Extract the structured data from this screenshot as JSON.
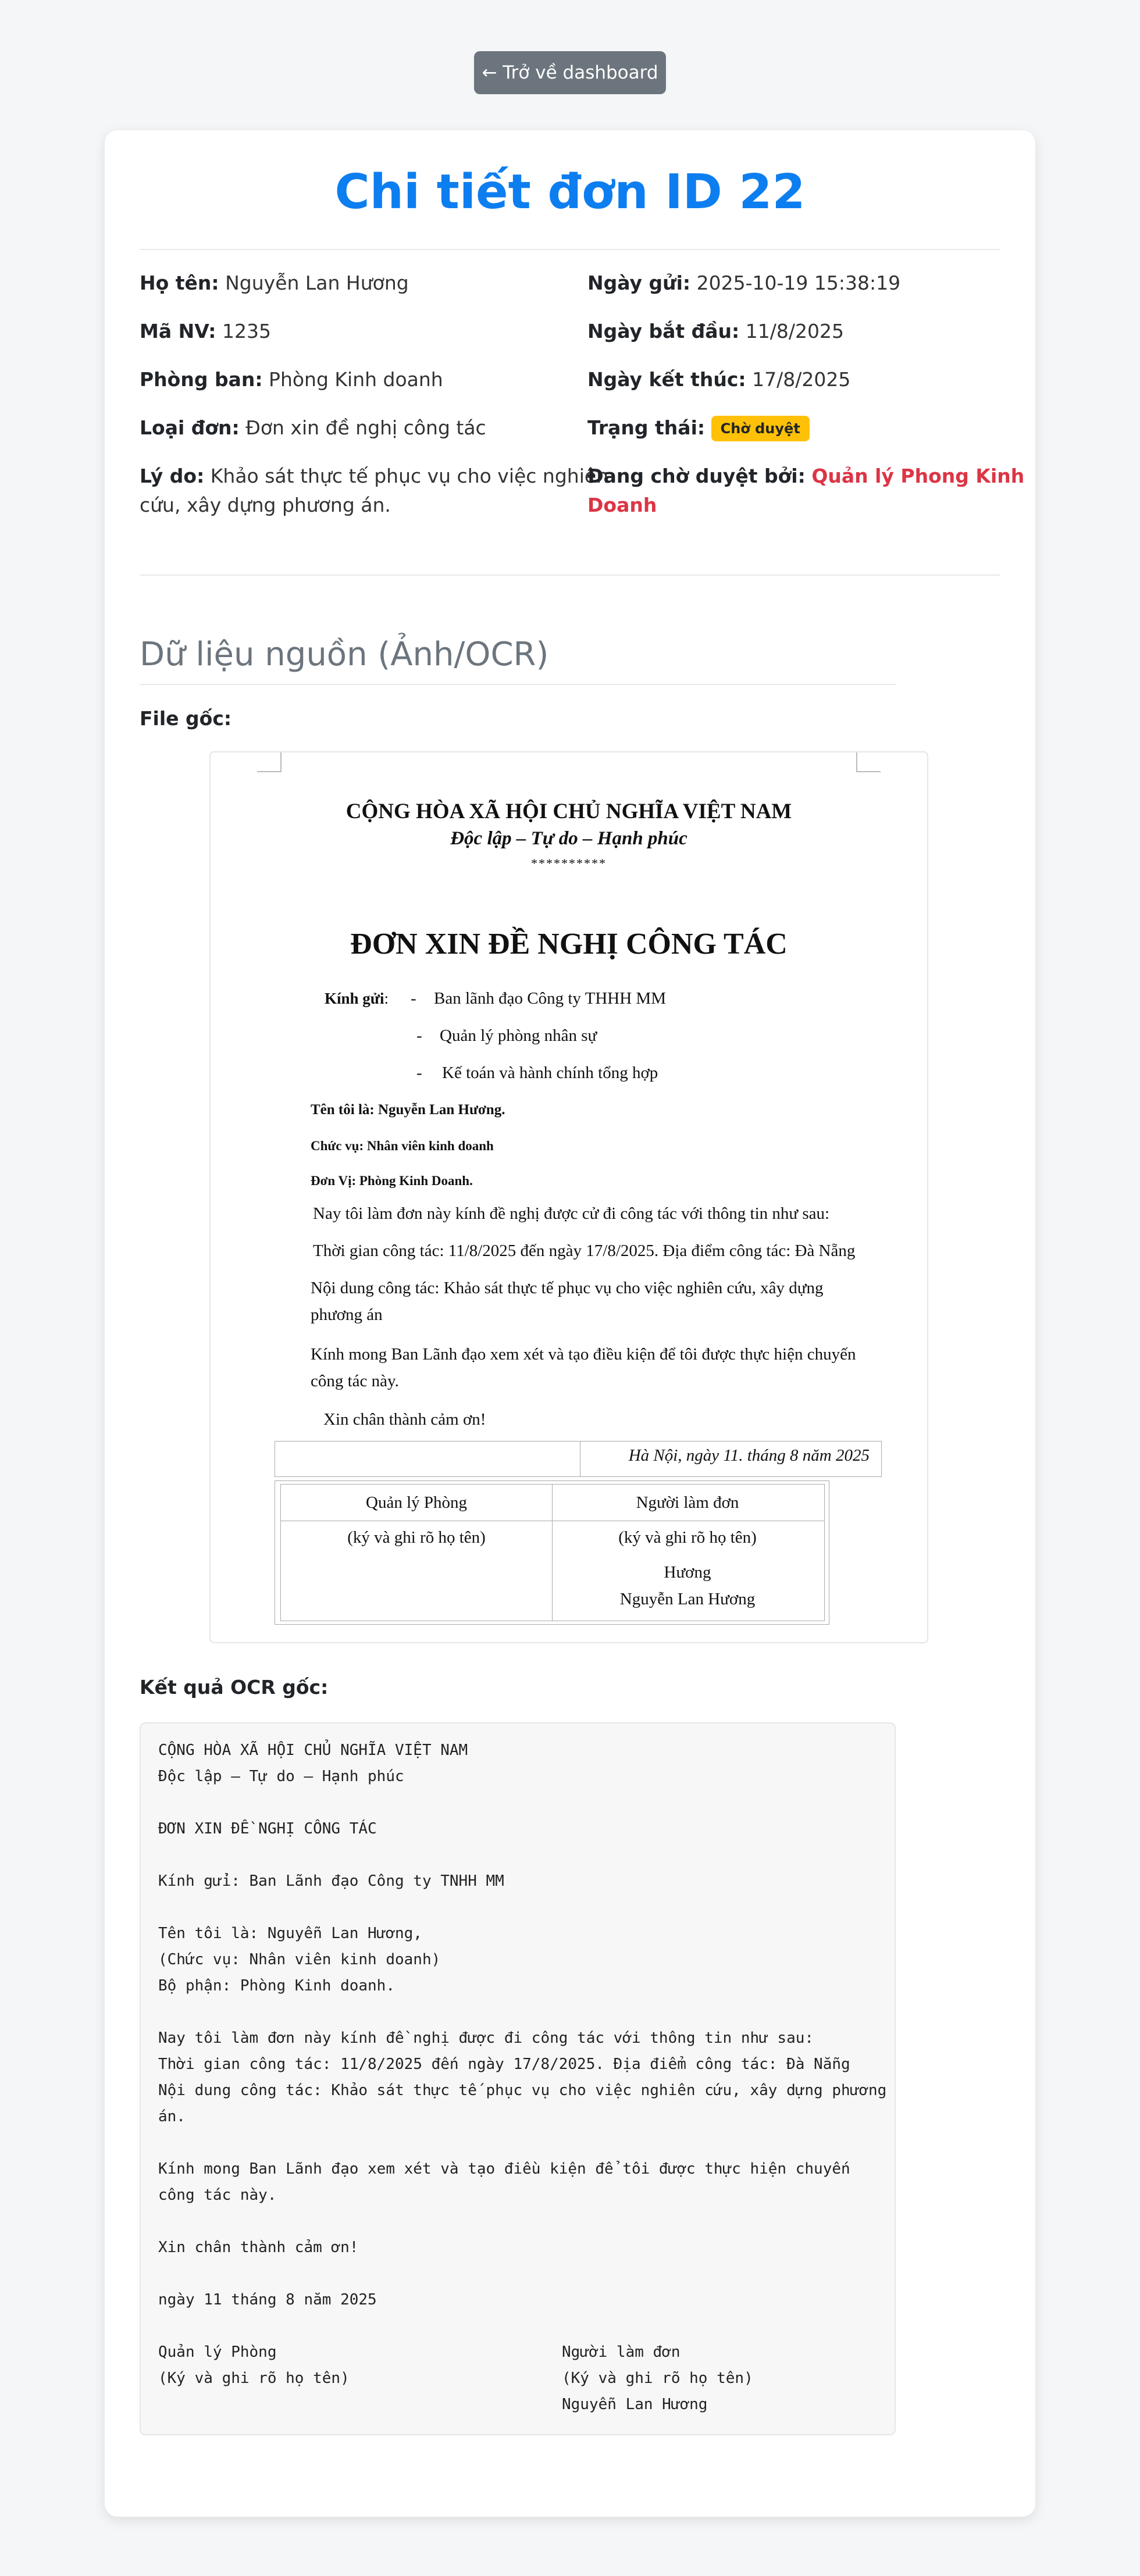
{
  "nav": {
    "back_label": "← Trở về dashboard"
  },
  "page_title": "Chi tiết đơn ID 22",
  "info": {
    "name_label": "Họ tên:",
    "name": "Nguyễn Lan Hương",
    "emp_label": "Mã NV:",
    "emp": "1235",
    "dept_label": "Phòng ban:",
    "dept": "Phòng Kinh doanh",
    "type_label": "Loại đơn:",
    "type": "Đơn xin đề nghị công tác",
    "reason_label": "Lý do:",
    "reason_1": "Khảo sát thực tế phục vụ cho việc nghiên",
    "reason_2": "cứu, xây dựng phương án.",
    "sent_label": "Ngày gửi:",
    "sent": "2025-10-19 15:38:19",
    "start_label": "Ngày bắt đầu:",
    "start": "11/8/2025",
    "end_label": "Ngày kết thúc:",
    "end": "17/8/2025",
    "status_label": "Trạng thái:",
    "status": "Chờ duyệt",
    "pending_label": "Đang chờ duyệt bởi:",
    "pending_1": "Quản lý Phong Kinh",
    "pending_2": "Doanh"
  },
  "source": {
    "section_title": "Dữ liệu nguồn (Ảnh/OCR)",
    "file_label": "File gốc:",
    "ocr_label": "Kết quả OCR gốc:"
  },
  "doc": {
    "nation": "CỘNG HÒA XÃ HỘI CHỦ NGHĨA VIỆT NAM",
    "motto": "Độc lập – Tự do – Hạnh phúc",
    "stars": "**********",
    "title": "ĐƠN XIN ĐỀ NGHỊ CÔNG TÁC",
    "to_label": "Kính gửi",
    "to_colon": ":",
    "recipients": [
      "Ban lãnh đạo Công ty THHH MM",
      "Quản lý phòng nhân sự",
      "Kế toán và hành chính tổng hợp"
    ],
    "dash": "-",
    "name_line": "Tên tôi là: Nguyễn Lan Hương.",
    "position_line": "Chức vụ: Nhân viên kinh doanh",
    "unit_line": "Đơn Vị: Phòng Kinh Doanh.",
    "p1": "Nay tôi làm đơn này kính đề nghị được cử đi công tác với thông tin như sau:",
    "p2": "Thời gian công tác: 11/8/2025 đến ngày 17/8/2025. Địa điểm công tác: Đà Nẵng",
    "p3a": "Nội dung công tác: Khảo sát thực tế phục vụ cho việc nghiên cứu, xây dựng",
    "p3b": "phương án",
    "p4a": "Kính mong Ban Lãnh đạo xem xét và tạo điều kiện để tôi được thực hiện chuyến",
    "p4b": "công tác này.",
    "thanks": "Xin chân thành cảm ơn!",
    "date": "Hà Nội, ngày 11. tháng 8 năm 2025",
    "sig_left_title": "Quản lý Phòng",
    "sig_left_note": "(ký và ghi rõ họ tên)",
    "sig_right_title": "Người làm đơn",
    "sig_right_note": "(ký và ghi rõ họ tên)",
    "sig_right_sign": "Hương",
    "sig_right_name": "Nguyễn Lan Hương"
  },
  "ocr_lines": [
    "CỘNG HÒA XÃ HỘI CHỦ NGHĨA VIỆT NAM",
    "Độc lập – Tự do – Hạnh phúc",
    "ĐƠN XIN ĐỀ NGHỊ CÔNG TÁC",
    "Kính gửi: Ban Lãnh đạo Công ty TNHH MM",
    "Tên tôi là: Nguyễn Lan Hương,",
    "(Chức vụ: Nhân viên kinh doanh)",
    "Bộ phận: Phòng Kinh doanh.",
    "Nay tôi làm đơn này kính đề nghị được đi công tác với thông tin như sau:",
    "Thời gian công tác: 11/8/2025 đến ngày 17/8/2025. Địa điểm công tác: Đà Nẵng",
    "Nội dung công tác: Khảo sát thực tế phục vụ cho việc nghiên cứu, xây dựng phương",
    "án.",
    "Kính mong Ban Lãnh đạo xem xét và tạo điều kiện để tôi được thực hiện chuyến",
    "công tác này.",
    "Xin chân thành cảm ơn!",
    "ngày 11 tháng 8 năm 2025",
    "Quản lý Phòng",
    "Người làm đơn",
    "(Ký và ghi rõ họ tên)",
    "(Ký và ghi rõ họ tên)",
    "Nguyễn Lan Hương"
  ]
}
